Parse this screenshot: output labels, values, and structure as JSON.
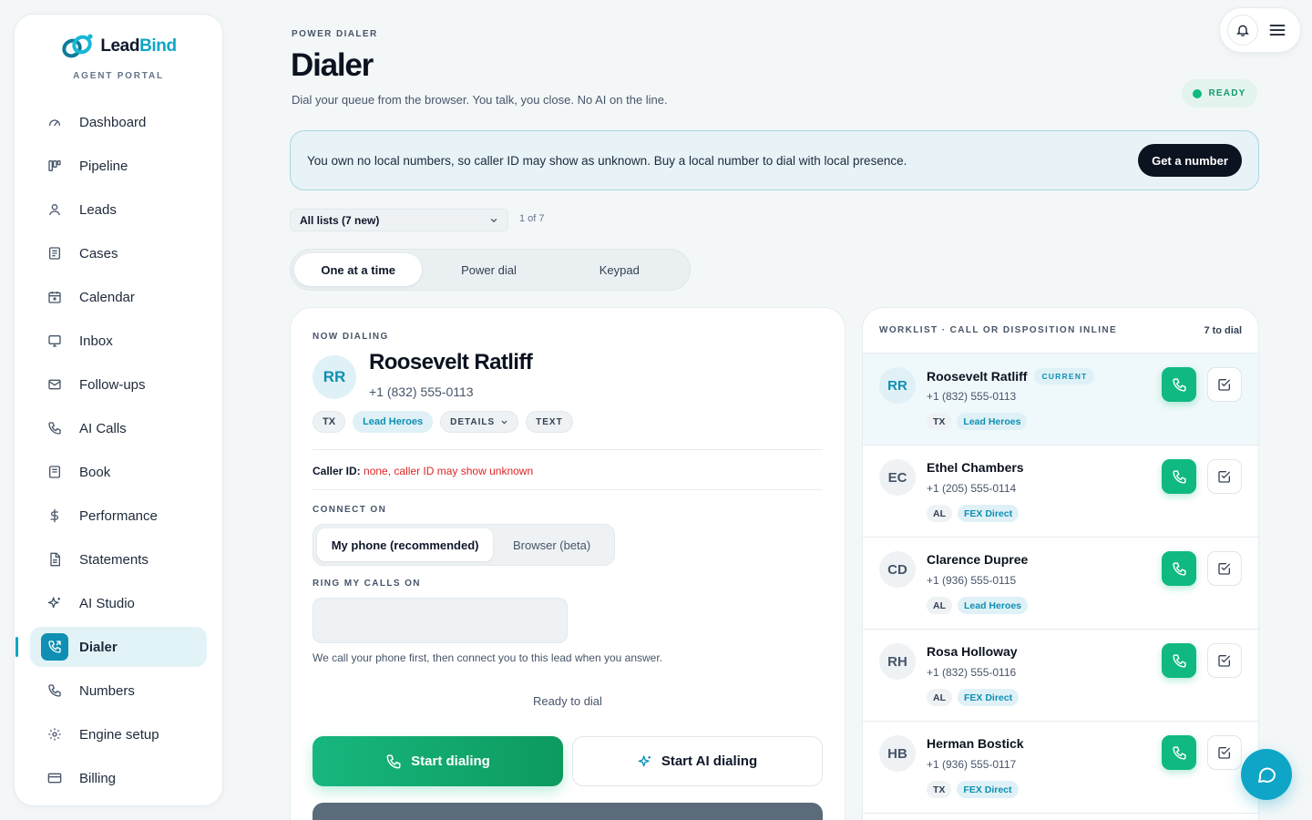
{
  "brand": {
    "name_main": "Lead",
    "name_accent": "Bind",
    "subtitle": "AGENT PORTAL"
  },
  "sidebar": {
    "items": [
      {
        "label": "Dashboard",
        "icon": "gauge-icon"
      },
      {
        "label": "Pipeline",
        "icon": "kanban-icon"
      },
      {
        "label": "Leads",
        "icon": "user-icon"
      },
      {
        "label": "Cases",
        "icon": "document-icon"
      },
      {
        "label": "Calendar",
        "icon": "calendar-icon"
      },
      {
        "label": "Inbox",
        "icon": "monitor-icon"
      },
      {
        "label": "Follow-ups",
        "icon": "mail-icon"
      },
      {
        "label": "AI Calls",
        "icon": "phone-icon"
      },
      {
        "label": "Book",
        "icon": "book-icon"
      },
      {
        "label": "Performance",
        "icon": "dollar-icon"
      },
      {
        "label": "Statements",
        "icon": "file-icon"
      },
      {
        "label": "AI Studio",
        "icon": "sparkle-icon"
      },
      {
        "label": "Dialer",
        "icon": "phone-forward-icon",
        "active": true
      },
      {
        "label": "Numbers",
        "icon": "phone-icon"
      },
      {
        "label": "Engine setup",
        "icon": "gear-icon"
      },
      {
        "label": "Billing",
        "icon": "credit-card-icon"
      }
    ]
  },
  "header": {
    "eyebrow": "POWER DIALER",
    "title": "Dialer",
    "subtitle": "Dial your queue from the browser. You talk, you close. No AI on the line.",
    "status": "READY"
  },
  "alert": {
    "text": "You own no local numbers, so caller ID may show as unknown. Buy a local number to dial with local presence.",
    "button": "Get a number"
  },
  "filter": {
    "list_value": "All lists (7 new)",
    "count": "1 of 7"
  },
  "modes": {
    "one": "One at a time",
    "power": "Power dial",
    "keypad": "Keypad"
  },
  "now_dialing": {
    "eyebrow": "NOW DIALING",
    "initials": "RR",
    "name": "Roosevelt Ratliff",
    "phone": "+1 (832) 555-0113",
    "state": "TX",
    "source": "Lead Heroes",
    "details_label": "DETAILS",
    "text_label": "TEXT",
    "caller_id_label": "Caller ID:",
    "caller_id_value": "none, caller ID may show unknown",
    "connect_label": "CONNECT ON",
    "connect_phone": "My phone (recommended)",
    "connect_browser": "Browser (beta)",
    "ring_label": "RING MY CALLS ON",
    "ring_value": "",
    "helper": "We call your phone first, then connect you to this lead when you answer.",
    "status": "Ready to dial",
    "start_label": "Start dialing",
    "ai_label": "Start AI dialing"
  },
  "worklist": {
    "title": "WORKLIST · CALL OR DISPOSITION INLINE",
    "count": "7 to dial",
    "current_badge": "CURRENT",
    "rows": [
      {
        "initials": "RR",
        "name": "Roosevelt Ratliff",
        "phone": "+1 (832) 555-0113",
        "state": "TX",
        "source": "Lead Heroes",
        "current": true
      },
      {
        "initials": "EC",
        "name": "Ethel Chambers",
        "phone": "+1 (205) 555-0114",
        "state": "AL",
        "source": "FEX Direct"
      },
      {
        "initials": "CD",
        "name": "Clarence Dupree",
        "phone": "+1 (936) 555-0115",
        "state": "AL",
        "source": "Lead Heroes"
      },
      {
        "initials": "RH",
        "name": "Rosa Holloway",
        "phone": "+1 (832) 555-0116",
        "state": "AL",
        "source": "FEX Direct"
      },
      {
        "initials": "HB",
        "name": "Herman Bostick",
        "phone": "+1 (936) 555-0117",
        "state": "TX",
        "source": "FEX Direct"
      }
    ]
  },
  "colors": {
    "accent": "#0ea5c6",
    "success": "#10b981",
    "dark": "#0b1220",
    "warning_text": "#dc2626"
  }
}
